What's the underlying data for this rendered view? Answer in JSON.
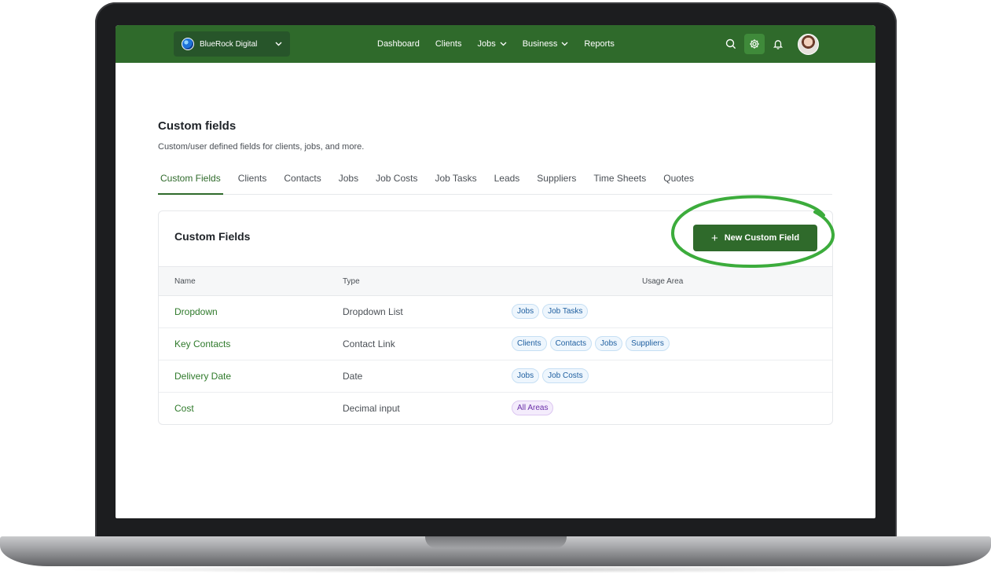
{
  "nav": {
    "org_name": "BlueRock Digital",
    "links": [
      {
        "label": "Dashboard",
        "has_dropdown": false
      },
      {
        "label": "Clients",
        "has_dropdown": false
      },
      {
        "label": "Jobs",
        "has_dropdown": true
      },
      {
        "label": "Business",
        "has_dropdown": true
      },
      {
        "label": "Reports",
        "has_dropdown": false
      }
    ],
    "icons": [
      "search-icon",
      "gear-icon",
      "bell-icon",
      "avatar"
    ],
    "accent": "#2f6a2b"
  },
  "page": {
    "title": "Custom fields",
    "subtitle": "Custom/user defined fields for clients, jobs, and more."
  },
  "tabs": [
    {
      "label": "Custom Fields",
      "active": true
    },
    {
      "label": "Clients",
      "active": false
    },
    {
      "label": "Contacts",
      "active": false
    },
    {
      "label": "Jobs",
      "active": false
    },
    {
      "label": "Job Costs",
      "active": false
    },
    {
      "label": "Job Tasks",
      "active": false
    },
    {
      "label": "Leads",
      "active": false
    },
    {
      "label": "Suppliers",
      "active": false
    },
    {
      "label": "Time Sheets",
      "active": false
    },
    {
      "label": "Quotes",
      "active": false
    }
  ],
  "card": {
    "title": "Custom Fields",
    "new_button_label": "New Custom Field",
    "columns": {
      "name": "Name",
      "type": "Type",
      "usage": "Usage Area"
    },
    "rows": [
      {
        "name": "Dropdown",
        "type": "Dropdown List",
        "tags": [
          "Jobs",
          "Job Tasks"
        ]
      },
      {
        "name": "Key Contacts",
        "type": "Contact Link",
        "tags": [
          "Clients",
          "Contacts",
          "Jobs",
          "Suppliers"
        ]
      },
      {
        "name": "Delivery Date",
        "type": "Date",
        "tags": [
          "Jobs",
          "Job Costs"
        ]
      },
      {
        "name": "Cost",
        "type": "Decimal input",
        "tags": [
          "All Areas"
        ]
      }
    ]
  }
}
